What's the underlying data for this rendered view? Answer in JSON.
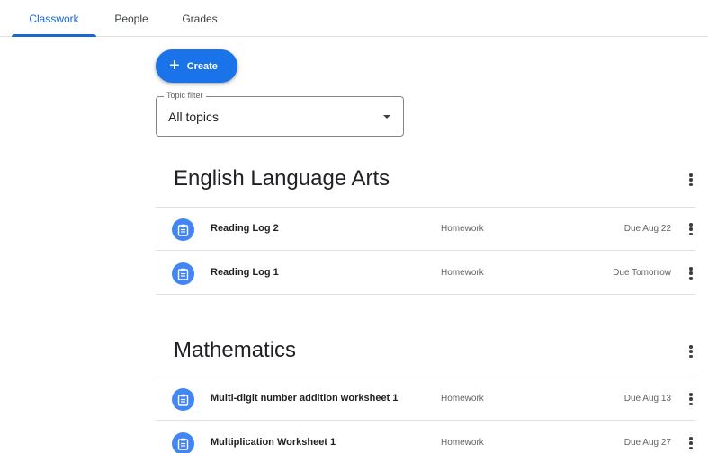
{
  "tabs": [
    {
      "label": "Classwork",
      "active": true
    },
    {
      "label": "People",
      "active": false
    },
    {
      "label": "Grades",
      "active": false
    }
  ],
  "create_button": {
    "icon": "plus-icon",
    "label": "Create"
  },
  "topic_filter": {
    "label": "Topic filter",
    "value": "All topics"
  },
  "topics": [
    {
      "title": "English Language Arts",
      "items": [
        {
          "title": "Reading Log 2",
          "category": "Homework",
          "due": "Due Aug 22"
        },
        {
          "title": "Reading Log 1",
          "category": "Homework",
          "due": "Due Tomorrow"
        }
      ]
    },
    {
      "title": "Mathematics",
      "items": [
        {
          "title": "Multi-digit number addition worksheet 1",
          "category": "Homework",
          "due": "Due Aug 13"
        },
        {
          "title": "Multiplication Worksheet 1",
          "category": "Homework",
          "due": "Due Aug 27"
        }
      ]
    }
  ],
  "colors": {
    "accent": "#1967d2",
    "button": "#1a73e8",
    "assignment_icon": "#4285f4"
  }
}
